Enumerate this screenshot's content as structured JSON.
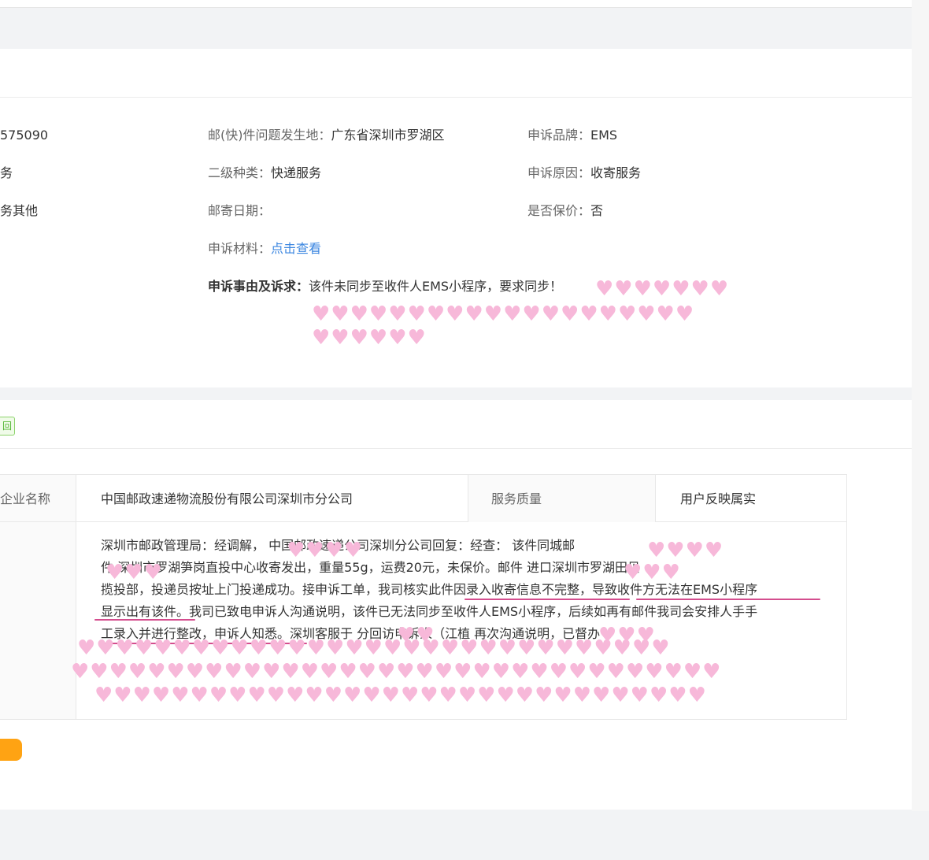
{
  "complaint": {
    "id_partial": "575090",
    "col1": {
      "row2_value": "务",
      "row3_value": "务其他"
    },
    "location_label": "邮(快)件问题发生地：",
    "location_value": "广东省深圳市罗湖区",
    "secondary_label": "二级种类：",
    "secondary_value": "快递服务",
    "date_label": "邮寄日期：",
    "date_value": "",
    "material_label": "申诉材料：",
    "material_link": "点击查看",
    "reason_detail_label": "申诉事由及诉求：",
    "reason_detail_value": "该件未同步至收件人EMS小程序，要求同步！",
    "brand_label": "申诉品牌：",
    "brand_value": "EMS",
    "reason_label": "申诉原因：",
    "reason_value": "收寄服务",
    "insured_label": "是否保价：",
    "insured_value": "否"
  },
  "reply": {
    "tag": "回",
    "company_header": "企业名称",
    "company_value": "中国邮政速递物流股份有限公司深圳市分公司",
    "quality_header": "服务质量",
    "quality_value": "用户反映属实",
    "lines": [
      "深圳市邮政管理局：经调解，                中国邮政速递公司深圳分公司回复：经查：                该件同城邮",
      "件              深圳市罗湖笋岗直投中心收寄发出，重量55g，运费20元，未保价。邮件              进口深圳市罗湖田贝",
      "揽投部，投递员按址上门投递成功。接申诉工单，我司核实此件因录入收寄信息不完整，导致收件方无法在EMS小程序",
      "显示出有该件。我司已致电申诉人沟通说明，该件已无法同步至收件人EMS小程序，后续如再有邮件我司会安排人手手",
      "工录入并进行整改，申诉人知悉。深圳客服于              分回访申诉人（江植               再次沟通说明，已督办"
    ]
  },
  "colors": {
    "accent_link": "#3b86e0",
    "highlight_underline": "#d44d8e",
    "tag_green": "#52b633",
    "button_orange": "#ffa313",
    "redaction_pink": "#f7b8d9"
  }
}
